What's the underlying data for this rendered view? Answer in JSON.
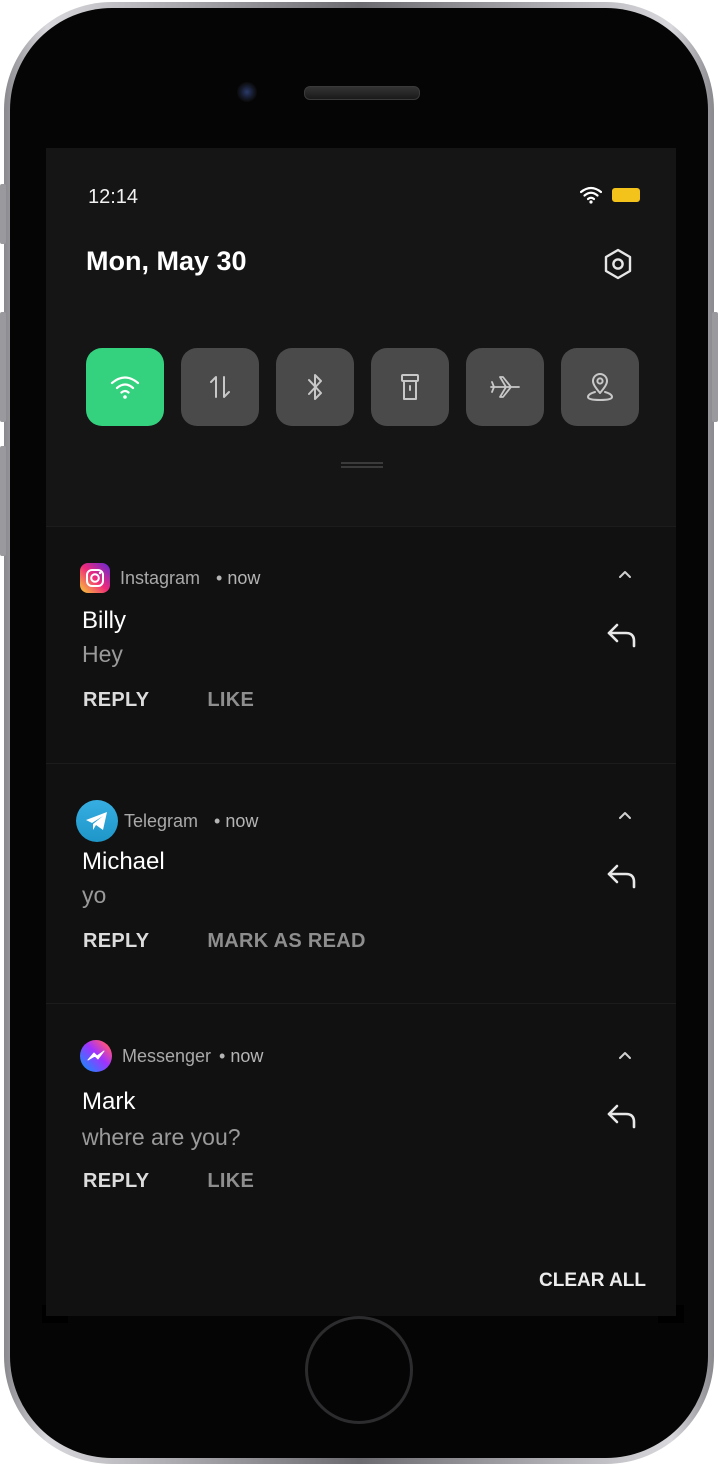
{
  "status_bar": {
    "time": "12:14"
  },
  "header": {
    "date": "Mon, May 30"
  },
  "quick_settings": [
    {
      "name": "wifi",
      "active": true
    },
    {
      "name": "mobile-data",
      "active": false
    },
    {
      "name": "bluetooth",
      "active": false
    },
    {
      "name": "flashlight",
      "active": false
    },
    {
      "name": "airplane-mode",
      "active": false
    },
    {
      "name": "location",
      "active": false
    }
  ],
  "notifications": [
    {
      "app": "Instagram",
      "time": "• now",
      "sender": "Billy",
      "message": "Hey",
      "actions": [
        "REPLY",
        "LIKE"
      ]
    },
    {
      "app": "Telegram",
      "time": "• now",
      "sender": "Michael",
      "message": "yo",
      "actions": [
        "REPLY",
        "MARK AS READ"
      ]
    },
    {
      "app": "Messenger",
      "time": "• now",
      "sender": "Mark",
      "message": "where are you?",
      "actions": [
        "REPLY",
        "LIKE"
      ]
    }
  ],
  "footer": {
    "clear_all": "CLEAR ALL"
  },
  "colors": {
    "accent": "#34d17e",
    "battery": "#f3c21b",
    "tile_off": "#4a4a4a",
    "background": "#111111"
  }
}
